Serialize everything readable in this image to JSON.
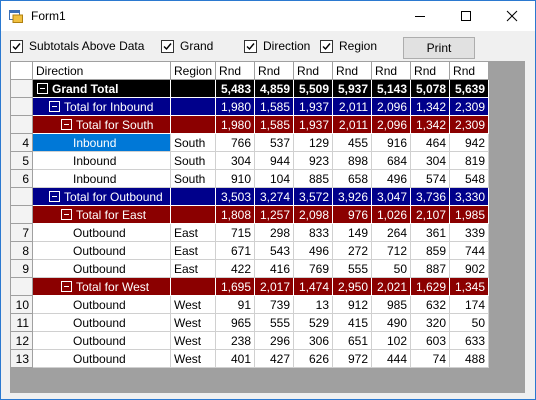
{
  "window": {
    "title": "Form1"
  },
  "toolbar": {
    "subtotals_label": "Subtotals Above Data",
    "grand_label": "Grand",
    "direction_label": "Direction",
    "region_label": "Region",
    "print_label": "Print"
  },
  "grid": {
    "columns": [
      "Direction",
      "Region",
      "Rnd",
      "Rnd",
      "Rnd",
      "Rnd",
      "Rnd",
      "Rnd",
      "Rnd"
    ],
    "rows": [
      {
        "kind": "gt",
        "header": "",
        "label": "Grand Total",
        "region": "",
        "values": [
          "5,483",
          "4,859",
          "5,509",
          "5,937",
          "5,143",
          "5,078",
          "5,639"
        ]
      },
      {
        "kind": "l1",
        "header": "",
        "label": "Total for Inbound",
        "region": "",
        "values": [
          "1,980",
          "1,585",
          "1,937",
          "2,011",
          "2,096",
          "1,342",
          "2,309"
        ]
      },
      {
        "kind": "l2",
        "header": "",
        "label": "Total for South",
        "region": "",
        "values": [
          "1,980",
          "1,585",
          "1,937",
          "2,011",
          "2,096",
          "1,342",
          "2,309"
        ]
      },
      {
        "kind": "data",
        "header": "4",
        "label": "Inbound",
        "region": "South",
        "values": [
          "766",
          "537",
          "129",
          "455",
          "916",
          "464",
          "942"
        ],
        "selected": true
      },
      {
        "kind": "data",
        "header": "5",
        "label": "Inbound",
        "region": "South",
        "values": [
          "304",
          "944",
          "923",
          "898",
          "684",
          "304",
          "819"
        ]
      },
      {
        "kind": "data",
        "header": "6",
        "label": "Inbound",
        "region": "South",
        "values": [
          "910",
          "104",
          "885",
          "658",
          "496",
          "574",
          "548"
        ]
      },
      {
        "kind": "l1",
        "header": "",
        "label": "Total for Outbound",
        "region": "",
        "values": [
          "3,503",
          "3,274",
          "3,572",
          "3,926",
          "3,047",
          "3,736",
          "3,330"
        ]
      },
      {
        "kind": "l2",
        "header": "",
        "label": "Total for East",
        "region": "",
        "values": [
          "1,808",
          "1,257",
          "2,098",
          "976",
          "1,026",
          "2,107",
          "1,985"
        ]
      },
      {
        "kind": "data",
        "header": "7",
        "label": "Outbound",
        "region": "East",
        "values": [
          "715",
          "298",
          "833",
          "149",
          "264",
          "361",
          "339"
        ]
      },
      {
        "kind": "data",
        "header": "8",
        "label": "Outbound",
        "region": "East",
        "values": [
          "671",
          "543",
          "496",
          "272",
          "712",
          "859",
          "744"
        ]
      },
      {
        "kind": "data",
        "header": "9",
        "label": "Outbound",
        "region": "East",
        "values": [
          "422",
          "416",
          "769",
          "555",
          "50",
          "887",
          "902"
        ]
      },
      {
        "kind": "l2",
        "header": "",
        "label": "Total for West",
        "region": "",
        "values": [
          "1,695",
          "2,017",
          "1,474",
          "2,950",
          "2,021",
          "1,629",
          "1,345"
        ]
      },
      {
        "kind": "data",
        "header": "10",
        "label": "Outbound",
        "region": "West",
        "values": [
          "91",
          "739",
          "13",
          "912",
          "985",
          "632",
          "174"
        ]
      },
      {
        "kind": "data",
        "header": "11",
        "label": "Outbound",
        "region": "West",
        "values": [
          "965",
          "555",
          "529",
          "415",
          "490",
          "320",
          "50"
        ]
      },
      {
        "kind": "data",
        "header": "12",
        "label": "Outbound",
        "region": "West",
        "values": [
          "238",
          "296",
          "306",
          "651",
          "102",
          "603",
          "633"
        ]
      },
      {
        "kind": "data",
        "header": "13",
        "label": "Outbound",
        "region": "West",
        "values": [
          "401",
          "427",
          "626",
          "972",
          "444",
          "74",
          "488"
        ]
      }
    ]
  },
  "icons": {
    "app": "form-icon",
    "minimize": "minimize-icon",
    "maximize": "maximize-icon",
    "close": "close-icon",
    "check": "check-icon",
    "collapse": "collapse-icon"
  }
}
